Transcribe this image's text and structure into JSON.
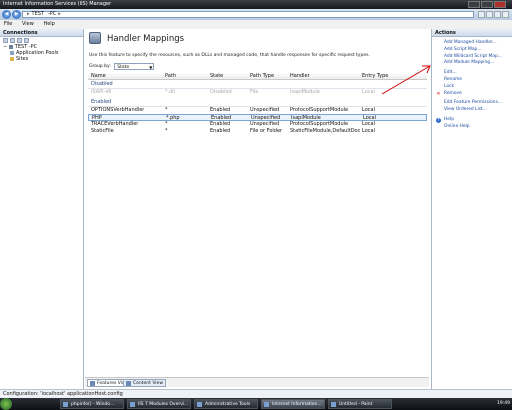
{
  "window": {
    "title": "Internet Information Services (IIS) Manager"
  },
  "address": {
    "crumbs": [
      "TEST",
      "-PC"
    ]
  },
  "menu": [
    "File",
    "View",
    "Help"
  ],
  "connections": {
    "header": "Connections",
    "tree": [
      {
        "label": "TEST          -PC",
        "level": 0
      },
      {
        "label": "Application Pools",
        "level": 1
      },
      {
        "label": "Sites",
        "level": 1
      }
    ]
  },
  "main": {
    "title": "Handler Mappings",
    "description": "Use this feature to specify the resources, such as DLLs and managed code, that handle responses for specific request types.",
    "group_by_label": "Group by:",
    "group_by_value": "State",
    "columns": [
      "Name",
      "Path",
      "State",
      "Path Type",
      "Handler",
      "Entry Type"
    ],
    "groups": [
      {
        "label": "Disabled",
        "rows": [
          {
            "name": "ISAPI-dll",
            "path": "*.dll",
            "state": "Disabled",
            "path_type": "File",
            "handler": "IsapiModule",
            "entry": "Local"
          }
        ]
      },
      {
        "label": "Enabled",
        "rows": [
          {
            "name": "OPTIONSVerbHandler",
            "path": "*",
            "state": "Enabled",
            "path_type": "Unspecified",
            "handler": "ProtocolSupportModule",
            "entry": "Local"
          },
          {
            "name": "PHP",
            "path": "*.php",
            "state": "Enabled",
            "path_type": "Unspecified",
            "handler": "IsapiModule",
            "entry": "Local",
            "selected": true
          },
          {
            "name": "TRACEVerbHandler",
            "path": "*",
            "state": "Enabled",
            "path_type": "Unspecified",
            "handler": "ProtocolSupportModule",
            "entry": "Local"
          },
          {
            "name": "StaticFile",
            "path": "*",
            "state": "Enabled",
            "path_type": "File or Folder",
            "handler": "StaticFileModule,DefaultDocu...",
            "entry": "Local"
          }
        ]
      }
    ],
    "tabs": [
      "Features View",
      "Content View"
    ]
  },
  "actions": {
    "header": "Actions",
    "items": [
      "Add Managed Handler...",
      "Add Script Map...",
      "Add Wildcard Script Map...",
      "Add Module Mapping...",
      "Edit...",
      "Rename",
      "Lock",
      "Remove",
      "Edit Feature Permissions...",
      "View Ordered List...",
      "Help",
      "Online Help"
    ]
  },
  "status": {
    "text": "Configuration: 'localhost' applicationHost.config"
  },
  "taskbar": {
    "items": [
      "phpinfo() - Windo...",
      "IIS 7 Modules Overvi...",
      "Administrative Tools",
      "Internet Information...",
      "Untitled - Paint"
    ],
    "clock": "19:49"
  },
  "colors": {
    "link": "#1a4aa0",
    "annotation_arrow": "#cc0000"
  }
}
